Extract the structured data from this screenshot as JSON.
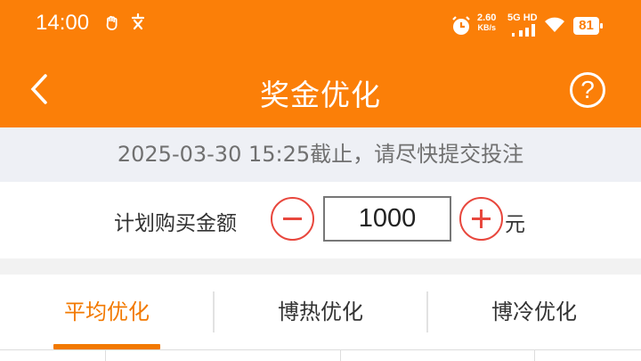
{
  "status_bar": {
    "time": "14:00",
    "speed_value": "2.60",
    "speed_unit": "KB/s",
    "network": "5G HD",
    "battery": "81"
  },
  "nav": {
    "title": "奖金优化",
    "back_icon": "chevron-left-icon",
    "help_icon": "question-circle-icon",
    "help_label": "?"
  },
  "notice": {
    "deadline_text": "2025-03-30 15:25截止，请尽快提交投注"
  },
  "purchase": {
    "label": "计划购买金额",
    "amount": "1000",
    "unit": "元",
    "decrease_icon": "minus-circle-icon",
    "increase_icon": "plus-circle-icon"
  },
  "tabs": [
    {
      "label": "平均优化",
      "active": true
    },
    {
      "label": "博热优化",
      "active": false
    },
    {
      "label": "博冷优化",
      "active": false
    }
  ],
  "colors": {
    "header": "#fb7f08",
    "accent": "#f27900",
    "stepper": "#e8473d",
    "notice_bg": "#eef0f5"
  }
}
